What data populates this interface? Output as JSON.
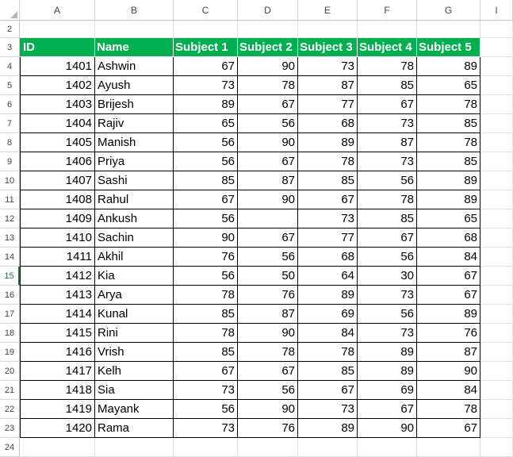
{
  "columns": [
    {
      "letter": "A",
      "width": 95
    },
    {
      "letter": "B",
      "width": 99
    },
    {
      "letter": "C",
      "width": 81
    },
    {
      "letter": "D",
      "width": 76
    },
    {
      "letter": "E",
      "width": 75
    },
    {
      "letter": "F",
      "width": 75
    },
    {
      "letter": "G",
      "width": 80
    },
    {
      "letter": "I",
      "width": 41
    }
  ],
  "rows": {
    "first_blank": "2",
    "header_row": "3",
    "last_blank": "24",
    "data_row_numbers": [
      "4",
      "5",
      "6",
      "7",
      "8",
      "9",
      "10",
      "11",
      "12",
      "13",
      "14",
      "15",
      "16",
      "17",
      "18",
      "19",
      "20",
      "21",
      "22",
      "23"
    ],
    "selected_row": "15"
  },
  "table": {
    "headers": [
      "ID",
      "Name",
      "Subject 1",
      "Subject 2",
      "Subject 3",
      "Subject 4",
      "Subject 5"
    ],
    "records": [
      [
        "1401",
        "Ashwin",
        "67",
        "90",
        "73",
        "78",
        "89"
      ],
      [
        "1402",
        "Ayush",
        "73",
        "78",
        "87",
        "85",
        "65"
      ],
      [
        "1403",
        "Brijesh",
        "89",
        "67",
        "77",
        "67",
        "78"
      ],
      [
        "1404",
        "Rajiv",
        "65",
        "56",
        "68",
        "73",
        "85"
      ],
      [
        "1405",
        "Manish",
        "56",
        "90",
        "89",
        "87",
        "78"
      ],
      [
        "1406",
        "Priya",
        "56",
        "67",
        "78",
        "73",
        "85"
      ],
      [
        "1407",
        "Sashi",
        "85",
        "87",
        "85",
        "56",
        "89"
      ],
      [
        "1408",
        "Rahul",
        "67",
        "90",
        "67",
        "78",
        "89"
      ],
      [
        "1409",
        "Ankush",
        "56",
        "",
        "73",
        "85",
        "65"
      ],
      [
        "1410",
        "Sachin",
        "90",
        "67",
        "77",
        "67",
        "68"
      ],
      [
        "1411",
        "Akhil",
        "76",
        "56",
        "68",
        "56",
        "84"
      ],
      [
        "1412",
        "Kia",
        "56",
        "50",
        "64",
        "30",
        "67"
      ],
      [
        "1413",
        "Arya",
        "78",
        "76",
        "89",
        "73",
        "67"
      ],
      [
        "1414",
        "Kunal",
        "85",
        "87",
        "69",
        "56",
        "89"
      ],
      [
        "1415",
        "Rini",
        "78",
        "90",
        "84",
        "73",
        "76"
      ],
      [
        "1416",
        "Vrish",
        "85",
        "78",
        "78",
        "89",
        "87"
      ],
      [
        "1417",
        "Kelh",
        "67",
        "67",
        "85",
        "89",
        "90"
      ],
      [
        "1418",
        "Sia",
        "73",
        "56",
        "67",
        "69",
        "84"
      ],
      [
        "1419",
        "Mayank",
        "56",
        "90",
        "73",
        "67",
        "78"
      ],
      [
        "1420",
        "Rama",
        "73",
        "76",
        "89",
        "90",
        "67"
      ]
    ]
  },
  "colors": {
    "header_fill": "#00b050",
    "header_text": "#ffffff",
    "selected_row_accent": "#217346"
  }
}
